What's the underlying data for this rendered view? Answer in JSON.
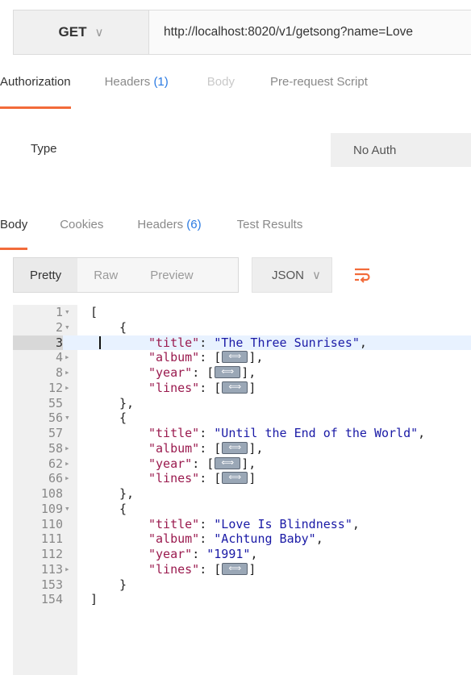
{
  "request": {
    "method": "GET",
    "url": "http://localhost:8020/v1/getsong?name=Love"
  },
  "request_tabs": [
    {
      "label": "Authorization",
      "count": ""
    },
    {
      "label": "Headers",
      "count": "(1)"
    },
    {
      "label": "Body",
      "count": ""
    },
    {
      "label": "Pre-request Script",
      "count": ""
    }
  ],
  "auth": {
    "type_label": "Type",
    "type_value": "No Auth"
  },
  "response_tabs": [
    {
      "label": "Body",
      "count": ""
    },
    {
      "label": "Cookies",
      "count": ""
    },
    {
      "label": "Headers",
      "count": "(6)"
    },
    {
      "label": "Test Results",
      "count": ""
    }
  ],
  "view_modes": [
    "Pretty",
    "Raw",
    "Preview"
  ],
  "format": "JSON",
  "icons": {
    "method_dropdown": "chevron-down-icon",
    "format_dropdown": "chevron-down-icon",
    "wrap": "wrap-lines-icon"
  },
  "colors": {
    "accent": "#f26b3a",
    "link_count": "#2a7ae2",
    "json_key": "#9a1a4e",
    "json_string": "#1a1aa6"
  },
  "editor": {
    "lines": [
      {
        "n": "1",
        "fold": "down",
        "indent": 0,
        "segs": [
          {
            "t": "[",
            "c": "punc"
          }
        ]
      },
      {
        "n": "2",
        "fold": "down",
        "indent": 1,
        "segs": [
          {
            "t": "{",
            "c": "punc"
          }
        ]
      },
      {
        "n": "3",
        "fold": "",
        "indent": 2,
        "active": true,
        "segs": [
          {
            "t": "\"title\"",
            "c": "key"
          },
          {
            "t": ": ",
            "c": "punc"
          },
          {
            "t": "\"The Three Sunrises\"",
            "c": "str"
          },
          {
            "t": ",",
            "c": "punc"
          }
        ]
      },
      {
        "n": "4",
        "fold": "right",
        "indent": 2,
        "segs": [
          {
            "t": "\"album\"",
            "c": "key"
          },
          {
            "t": ": [",
            "c": "punc"
          },
          {
            "ph": true
          },
          {
            "t": "],",
            "c": "punc"
          }
        ]
      },
      {
        "n": "8",
        "fold": "right",
        "indent": 2,
        "segs": [
          {
            "t": "\"year\"",
            "c": "key"
          },
          {
            "t": ": [",
            "c": "punc"
          },
          {
            "ph": true
          },
          {
            "t": "],",
            "c": "punc"
          }
        ]
      },
      {
        "n": "12",
        "fold": "right",
        "indent": 2,
        "segs": [
          {
            "t": "\"lines\"",
            "c": "key"
          },
          {
            "t": ": [",
            "c": "punc"
          },
          {
            "ph": true
          },
          {
            "t": "]",
            "c": "punc"
          }
        ]
      },
      {
        "n": "55",
        "fold": "",
        "indent": 1,
        "segs": [
          {
            "t": "},",
            "c": "punc"
          }
        ]
      },
      {
        "n": "56",
        "fold": "down",
        "indent": 1,
        "segs": [
          {
            "t": "{",
            "c": "punc"
          }
        ]
      },
      {
        "n": "57",
        "fold": "",
        "indent": 2,
        "segs": [
          {
            "t": "\"title\"",
            "c": "key"
          },
          {
            "t": ": ",
            "c": "punc"
          },
          {
            "t": "\"Until the End of the World\"",
            "c": "str"
          },
          {
            "t": ",",
            "c": "punc"
          }
        ]
      },
      {
        "n": "58",
        "fold": "right",
        "indent": 2,
        "segs": [
          {
            "t": "\"album\"",
            "c": "key"
          },
          {
            "t": ": [",
            "c": "punc"
          },
          {
            "ph": true
          },
          {
            "t": "],",
            "c": "punc"
          }
        ]
      },
      {
        "n": "62",
        "fold": "right",
        "indent": 2,
        "segs": [
          {
            "t": "\"year\"",
            "c": "key"
          },
          {
            "t": ": [",
            "c": "punc"
          },
          {
            "ph": true
          },
          {
            "t": "],",
            "c": "punc"
          }
        ]
      },
      {
        "n": "66",
        "fold": "right",
        "indent": 2,
        "segs": [
          {
            "t": "\"lines\"",
            "c": "key"
          },
          {
            "t": ": [",
            "c": "punc"
          },
          {
            "ph": true
          },
          {
            "t": "]",
            "c": "punc"
          }
        ]
      },
      {
        "n": "108",
        "fold": "",
        "indent": 1,
        "segs": [
          {
            "t": "},",
            "c": "punc"
          }
        ]
      },
      {
        "n": "109",
        "fold": "down",
        "indent": 1,
        "segs": [
          {
            "t": "{",
            "c": "punc"
          }
        ]
      },
      {
        "n": "110",
        "fold": "",
        "indent": 2,
        "segs": [
          {
            "t": "\"title\"",
            "c": "key"
          },
          {
            "t": ": ",
            "c": "punc"
          },
          {
            "t": "\"Love Is Blindness\"",
            "c": "str"
          },
          {
            "t": ",",
            "c": "punc"
          }
        ]
      },
      {
        "n": "111",
        "fold": "",
        "indent": 2,
        "segs": [
          {
            "t": "\"album\"",
            "c": "key"
          },
          {
            "t": ": ",
            "c": "punc"
          },
          {
            "t": "\"Achtung Baby\"",
            "c": "str"
          },
          {
            "t": ",",
            "c": "punc"
          }
        ]
      },
      {
        "n": "112",
        "fold": "",
        "indent": 2,
        "segs": [
          {
            "t": "\"year\"",
            "c": "key"
          },
          {
            "t": ": ",
            "c": "punc"
          },
          {
            "t": "\"1991\"",
            "c": "str"
          },
          {
            "t": ",",
            "c": "punc"
          }
        ]
      },
      {
        "n": "113",
        "fold": "right",
        "indent": 2,
        "segs": [
          {
            "t": "\"lines\"",
            "c": "key"
          },
          {
            "t": ": [",
            "c": "punc"
          },
          {
            "ph": true
          },
          {
            "t": "]",
            "c": "punc"
          }
        ]
      },
      {
        "n": "153",
        "fold": "",
        "indent": 1,
        "segs": [
          {
            "t": "}",
            "c": "punc"
          }
        ]
      },
      {
        "n": "154",
        "fold": "",
        "indent": 0,
        "segs": [
          {
            "t": "]",
            "c": "punc"
          }
        ]
      }
    ]
  }
}
